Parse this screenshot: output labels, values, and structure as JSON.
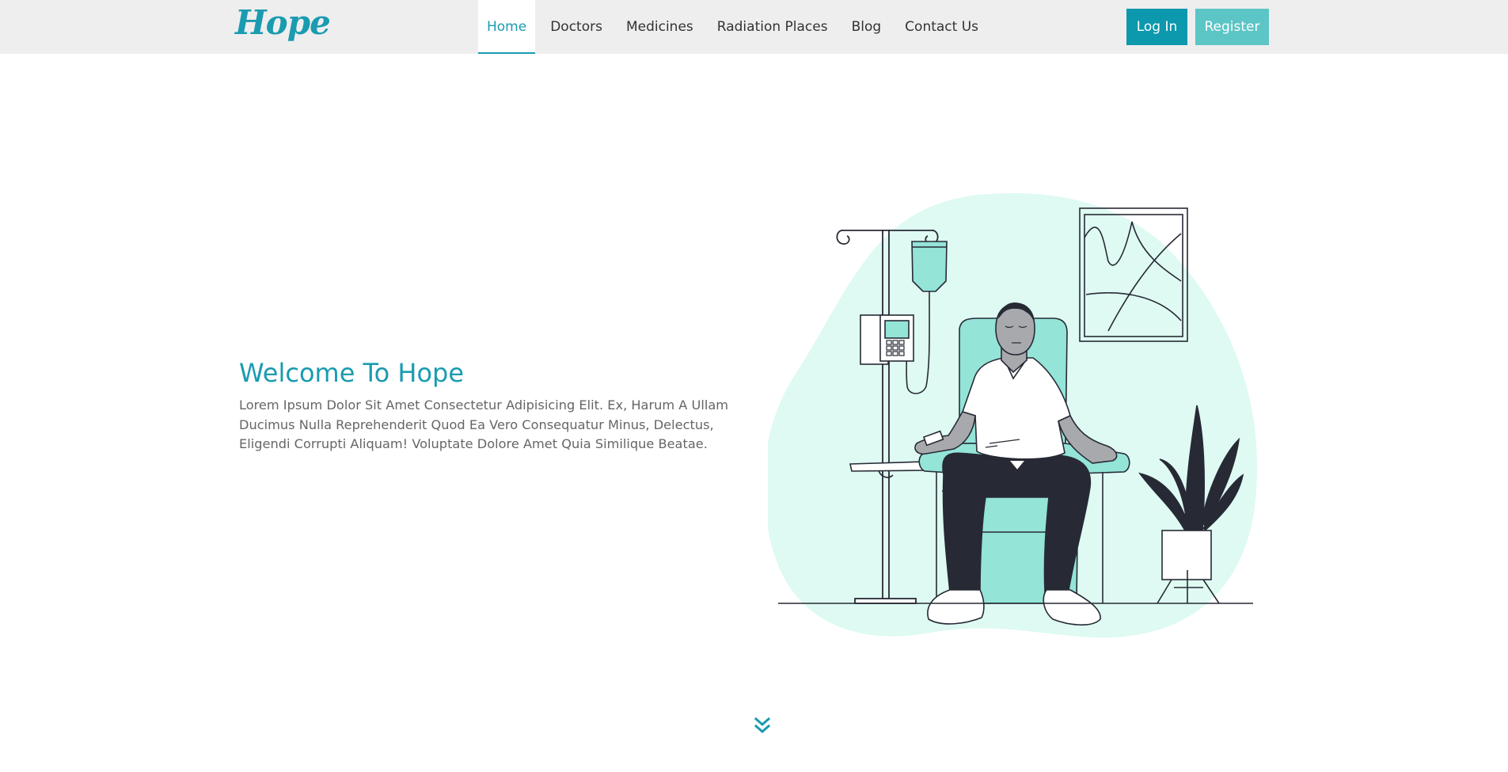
{
  "brand": {
    "logo_text": "Hope"
  },
  "nav": {
    "items": [
      {
        "label": "Home",
        "active": true
      },
      {
        "label": "Doctors"
      },
      {
        "label": "Medicines"
      },
      {
        "label": "Radiation Places"
      },
      {
        "label": "Blog"
      },
      {
        "label": "Contact Us"
      }
    ]
  },
  "auth": {
    "login_label": "Log In",
    "register_label": "Register"
  },
  "hero": {
    "title": "Welcome To Hope",
    "text": "Lorem Ipsum Dolor Sit Amet Consectetur Adipisicing Elit. Ex, Harum A Ullam Ducimus Nulla Reprehenderit Quod Ea Vero Consequatur Minus, Delectus, Eligendi Corrupti Aliquam! Voluptate Dolore Amet Quia Similique Beatae."
  },
  "icons": {
    "scroll": "double-chevron-down-icon",
    "illustration": "patient-iv-illustration"
  },
  "colors": {
    "accent": "#1a9bb0",
    "login_bg": "#0c98ad",
    "register_bg": "#5cc5c6",
    "blob": "#defaf2",
    "chair": "#94e4d8",
    "dark": "#272a35",
    "navbar_bg": "#eeeeee",
    "body_text": "#666666"
  }
}
